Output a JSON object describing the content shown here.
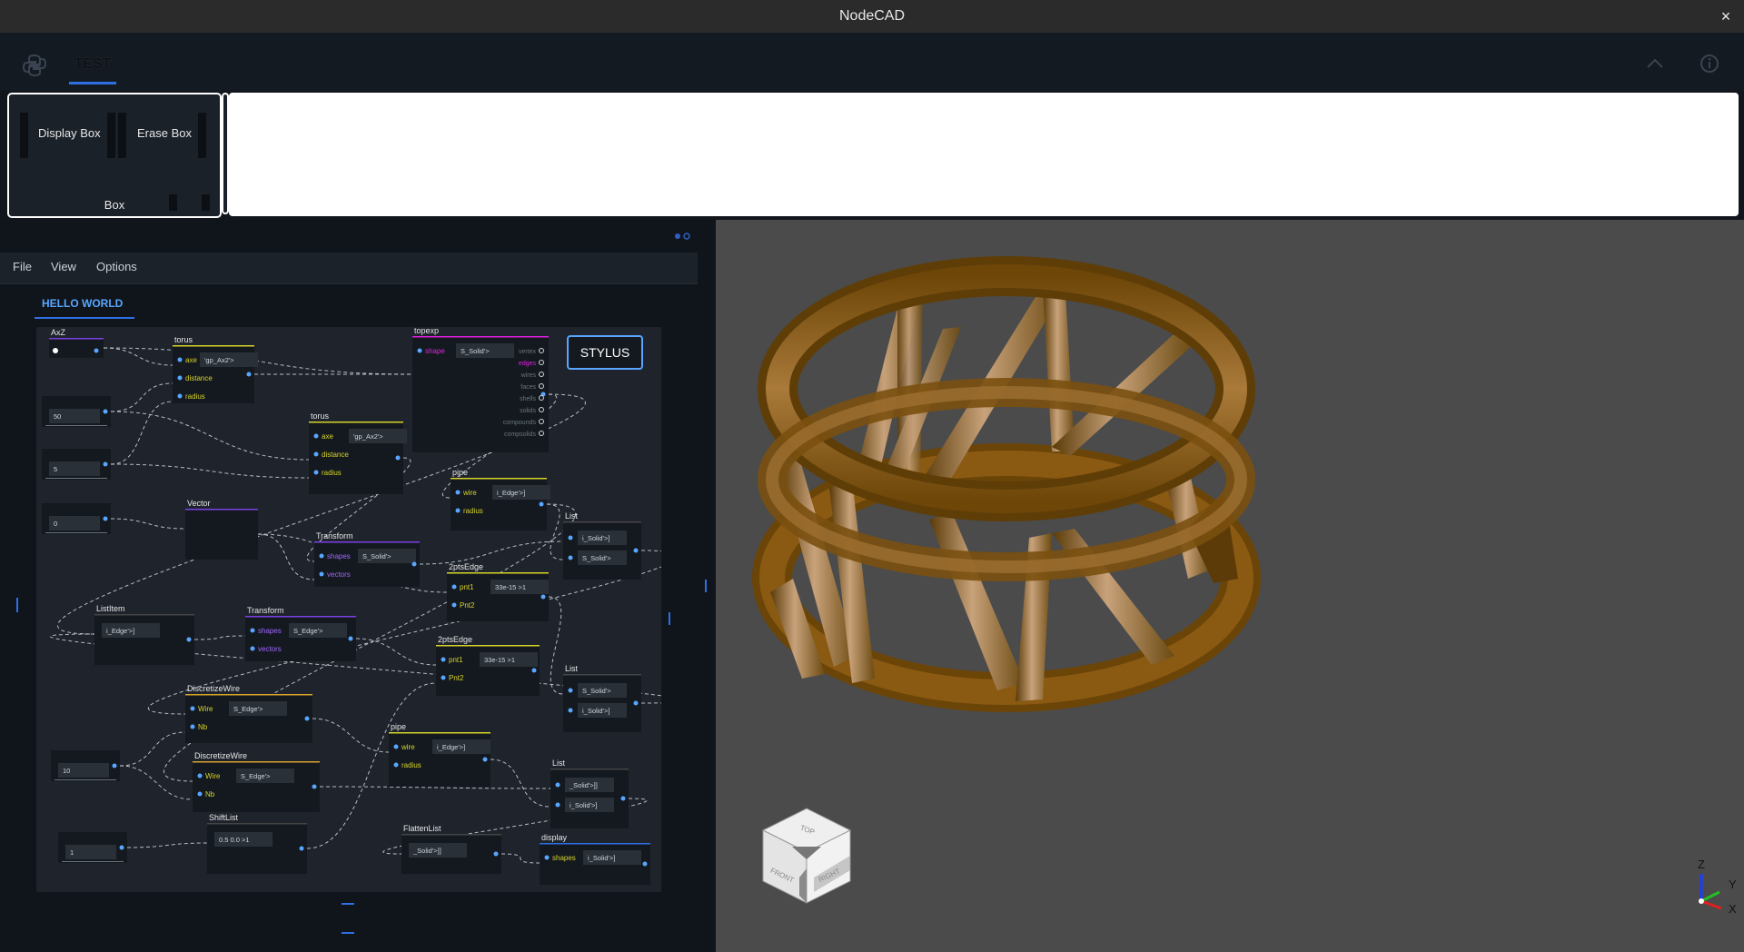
{
  "window": {
    "title": "NodeCAD",
    "close_label": "×"
  },
  "tabs": [
    {
      "label": "TEST",
      "active": true
    }
  ],
  "toolbar": {
    "group_label": "Box",
    "buttons": [
      {
        "label": "Display Box"
      },
      {
        "label": "Erase Box"
      }
    ]
  },
  "editor": {
    "menu": [
      "File",
      "View",
      "Options"
    ],
    "graph_tab": "HELLO WORLD",
    "stylus_label": "STYLUS",
    "nodes": [
      {
        "id": "axz",
        "title": "AxZ",
        "color": "#7b3fe4"
      },
      {
        "id": "torus1",
        "title": "torus",
        "color": "#d7d42a",
        "ports": [
          "axe",
          "distance",
          "radius"
        ],
        "value": "'gp_Ax2'>"
      },
      {
        "id": "torus2",
        "title": "torus",
        "color": "#d7d42a",
        "ports": [
          "axe",
          "distance",
          "radius"
        ],
        "value": "'gp_Ax2'>"
      },
      {
        "id": "topexp",
        "title": "topexp",
        "color": "#e020e0",
        "ports": [
          "shape"
        ],
        "value": "S_Solid'>",
        "outputs": [
          "vertex",
          "edges",
          "wires",
          "faces",
          "shells",
          "solids",
          "compounds",
          "compsolids"
        ]
      },
      {
        "id": "num1",
        "value": "50"
      },
      {
        "id": "num2",
        "value": "5"
      },
      {
        "id": "num3",
        "value": "0"
      },
      {
        "id": "vector",
        "title": "Vector",
        "color": "#7b3fe4"
      },
      {
        "id": "transform1",
        "title": "Transform",
        "color": "#7b3fe4",
        "ports": [
          "shapes",
          "vectors"
        ],
        "value": "S_Solid'>"
      },
      {
        "id": "pipe1",
        "title": "pipe",
        "color": "#d7d42a",
        "ports": [
          "wire",
          "radius"
        ],
        "value": "i_Edge'>]"
      },
      {
        "id": "list1",
        "title": "List",
        "color": "#444",
        "values": [
          "i_Solid'>]",
          "S_Solid'>"
        ]
      },
      {
        "id": "twopts1",
        "title": "2ptsEdge",
        "color": "#d7d42a",
        "ports": [
          "pnt1",
          "Pnt2"
        ],
        "value": "33e-15 >1"
      },
      {
        "id": "listitem",
        "title": "ListItem",
        "color": "#444",
        "value": "i_Edge'>]"
      },
      {
        "id": "transform2",
        "title": "Transform",
        "color": "#7b3fe4",
        "ports": [
          "shapes",
          "vectors"
        ],
        "value": "S_Edge'>"
      },
      {
        "id": "twopts2",
        "title": "2ptsEdge",
        "color": "#d7d42a",
        "ports": [
          "pnt1",
          "Pnt2"
        ],
        "value": "33e-15 >1"
      },
      {
        "id": "list2",
        "title": "List",
        "color": "#444",
        "values": [
          "S_Solid'>",
          "i_Solid'>]"
        ]
      },
      {
        "id": "discwire1",
        "title": "DiscretizeWire",
        "color": "#d7a42a",
        "ports": [
          "Wire",
          "Nb"
        ],
        "value": "S_Edge'>"
      },
      {
        "id": "pipe2",
        "title": "pipe",
        "color": "#d7d42a",
        "ports": [
          "wire",
          "radius"
        ],
        "value": "i_Edge'>]"
      },
      {
        "id": "num4",
        "value": "10"
      },
      {
        "id": "discwire2",
        "title": "DiscretizeWire",
        "color": "#d7a42a",
        "ports": [
          "Wire",
          "Nb"
        ],
        "value": "S_Edge'>"
      },
      {
        "id": "list3",
        "title": "List",
        "color": "#444",
        "values": [
          "_Solid'>]]",
          "i_Solid'>]"
        ]
      },
      {
        "id": "shiftlist",
        "title": "ShiftList",
        "color": "#444",
        "value": "0.5 0.0 >1"
      },
      {
        "id": "flattenlist",
        "title": "FlattenList",
        "color": "#444",
        "value": "_Solid'>]]"
      },
      {
        "id": "display",
        "title": "display",
        "color": "#2f6fe4",
        "ports": [
          "shapes"
        ],
        "value": "i_Solid'>]"
      },
      {
        "id": "num5",
        "value": "1"
      }
    ]
  },
  "viewer": {
    "background": "#4b4b4b",
    "shape_color": "#8a5a12",
    "navcube": {
      "top": "TOP",
      "front": "FRONT",
      "right": "RIGHT"
    },
    "axes": {
      "z": "Z",
      "y": "Y",
      "x": "X"
    }
  }
}
